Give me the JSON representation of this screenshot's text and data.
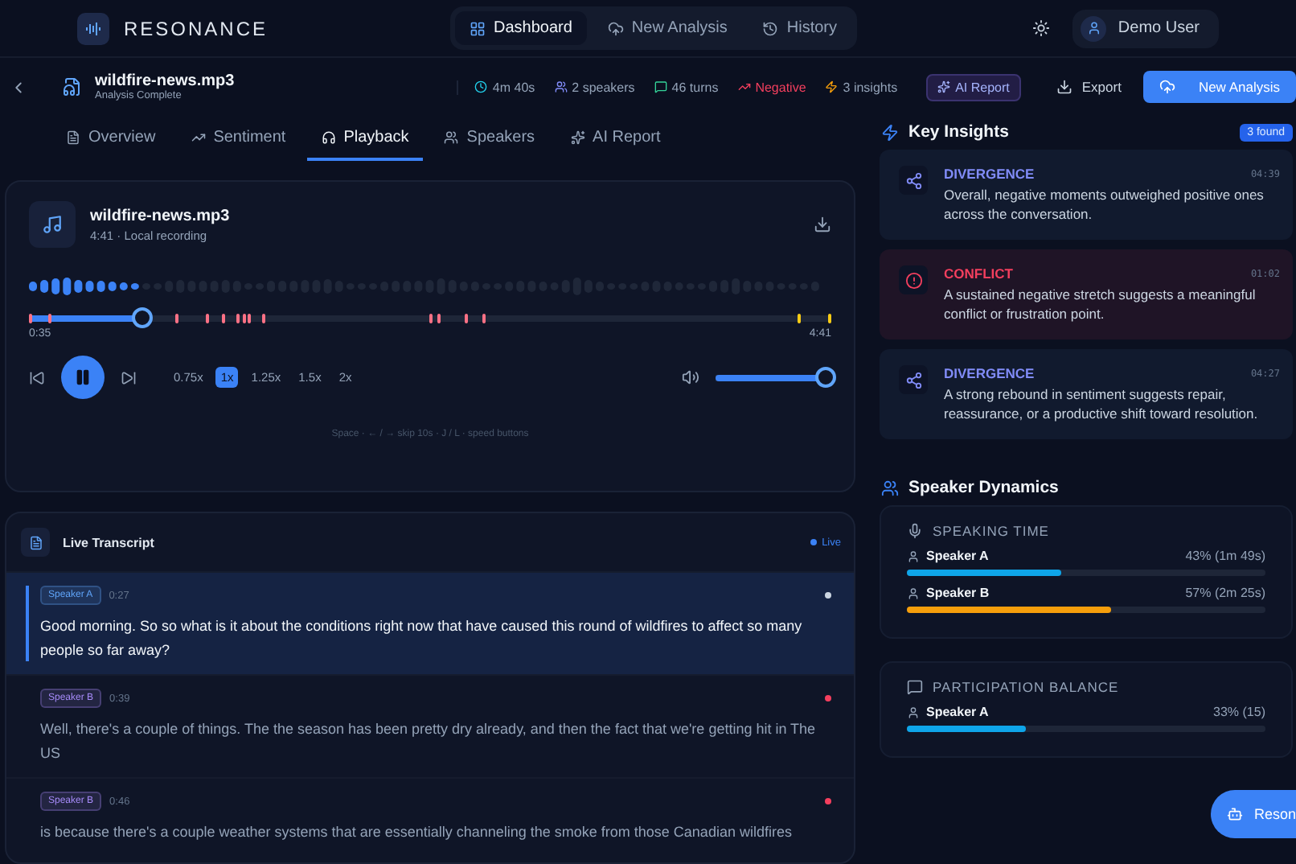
{
  "app": {
    "brand": "RESONANCE",
    "nav": [
      {
        "label": "Dashboard",
        "selected": true
      },
      {
        "label": "New Analysis",
        "selected": false
      },
      {
        "label": "History",
        "selected": false
      }
    ],
    "user": "Demo User"
  },
  "file": {
    "name": "wildfire-news.mp3",
    "status": "Analysis Complete",
    "stats": [
      {
        "kind": "time",
        "text": "4m 40s"
      },
      {
        "kind": "speakers",
        "text": "2 speakers"
      },
      {
        "kind": "turns",
        "text": "46 turns"
      },
      {
        "kind": "negative",
        "text": "Negative"
      },
      {
        "kind": "insights",
        "text": "3 insights"
      }
    ],
    "ai_report": "AI Report",
    "export": "Export",
    "new_analysis": "New Analysis"
  },
  "tabs": [
    {
      "label": "Overview",
      "selected": false
    },
    {
      "label": "Sentiment",
      "selected": false
    },
    {
      "label": "Playback",
      "selected": true
    },
    {
      "label": "Speakers",
      "selected": false
    },
    {
      "label": "AI Report",
      "selected": false
    }
  ],
  "player": {
    "title": "wildfire-news.mp3",
    "meta": "4:41 · Local recording",
    "current": "0:35",
    "total": "4:41",
    "level": 0.14,
    "speeds": [
      {
        "label": "0.75x",
        "selected": false
      },
      {
        "label": "1x",
        "selected": true
      },
      {
        "label": "1.25x",
        "selected": false
      },
      {
        "label": "1.5x",
        "selected": false
      },
      {
        "label": "2x",
        "selected": false
      }
    ],
    "volume": {
      "level": 0.95
    },
    "hint": "Space · ← / → skip 10s · J / L · speed buttons"
  },
  "transcript": {
    "title": "Live Transcript",
    "live": "Live",
    "entries": [
      {
        "speaker": {
          "name": "Speaker A",
          "color": "#60a5fa"
        },
        "time": "0:27",
        "text": "Good morning. So so what is it about the conditions right now that have caused this round of wildfires to affect so many people so far away?",
        "active": true,
        "sentiment": {
          "color": "#cbd5e1"
        }
      },
      {
        "speaker": {
          "name": "Speaker B",
          "color": "#a78bfa"
        },
        "time": "0:39",
        "text": "Well, there's a couple of things. The the season has been pretty dry already, and then the fact that we're getting hit in The US",
        "active": false,
        "sentiment": {
          "color": "#f43f5e"
        }
      },
      {
        "speaker": {
          "name": "Speaker B",
          "color": "#a78bfa"
        },
        "time": "0:46",
        "text": "is because there's a couple weather systems that are essentially channeling the smoke from those Canadian wildfires",
        "active": false,
        "sentiment": {
          "color": "#f43f5e"
        }
      }
    ]
  },
  "insights": {
    "title": "Key Insights",
    "count": "3 found",
    "items": [
      {
        "kind": "divergence",
        "label": "DIVERGENCE",
        "time": "04:39",
        "text": "Overall, negative moments outweighed positive ones across the conversation."
      },
      {
        "kind": "conflict",
        "label": "CONFLICT",
        "time": "01:02",
        "text": "A sustained negative stretch suggests a meaningful conflict or frustration point."
      },
      {
        "kind": "divergence",
        "label": "DIVERGENCE",
        "time": "04:27",
        "text": "A strong rebound in sentiment suggests repair, reassurance, or a productive shift toward resolution."
      }
    ]
  },
  "dynamics": {
    "title": "Speaker Dynamics",
    "sections": [
      {
        "kind": "time",
        "title": "SPEAKING TIME",
        "speakers": [
          {
            "name": "Speaker A",
            "reading": "43% (1m 49s)",
            "level": 0.43,
            "color": "#0ea5e9"
          },
          {
            "name": "Speaker B",
            "reading": "57% (2m 25s)",
            "level": 0.57,
            "color": "#f59e0b"
          }
        ]
      },
      {
        "kind": "balance",
        "title": "PARTICIPATION BALANCE",
        "speakers": [
          {
            "name": "Speaker A",
            "reading": "33% (15)",
            "level": 0.33,
            "color": "#0ea5e9"
          }
        ]
      }
    ]
  },
  "assistant": {
    "label": "Reson"
  }
}
